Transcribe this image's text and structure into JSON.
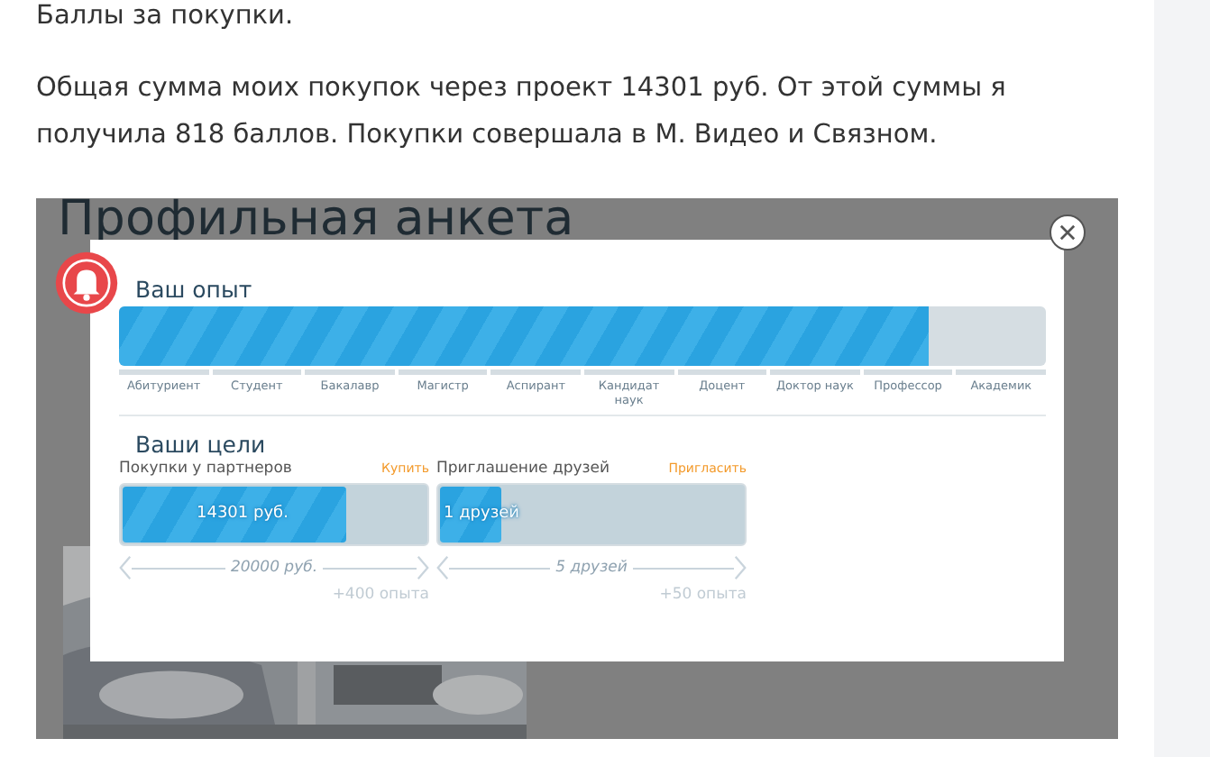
{
  "article": {
    "paragraphs": [
      "Баллы за покупки.",
      "Общая сумма моих покупок через проект 14301 руб. От этой суммы я получила 818 баллов. Покупки совершала в М. Видео и Связном."
    ]
  },
  "screenshot": {
    "page_title": "Профильная анкета",
    "modal": {
      "experience": {
        "title": "Ваш опыт",
        "level": 0.873,
        "ranks": [
          {
            "label": "Абитуриент"
          },
          {
            "label": "Студент"
          },
          {
            "label": "Бакалавр"
          },
          {
            "label": "Магистр"
          },
          {
            "label": "Аспирант"
          },
          {
            "label": "Кандидат наук"
          },
          {
            "label": "Доцент"
          },
          {
            "label": "Доктор наук"
          },
          {
            "label": "Профессор"
          },
          {
            "label": "Академик"
          }
        ]
      },
      "goals": {
        "title": "Ваши цели",
        "items": [
          {
            "name": "Покупки у партнеров",
            "action": "Купить",
            "value": "14301 руб.",
            "level": 0.73,
            "target": "20000 руб.",
            "reward": "+400 опыта"
          },
          {
            "name": "Приглашение друзей",
            "action": "Пригласить",
            "value": "1 друзей",
            "level": 0.2,
            "target": "5 друзей",
            "reward": "+50 опыта"
          }
        ]
      }
    }
  }
}
